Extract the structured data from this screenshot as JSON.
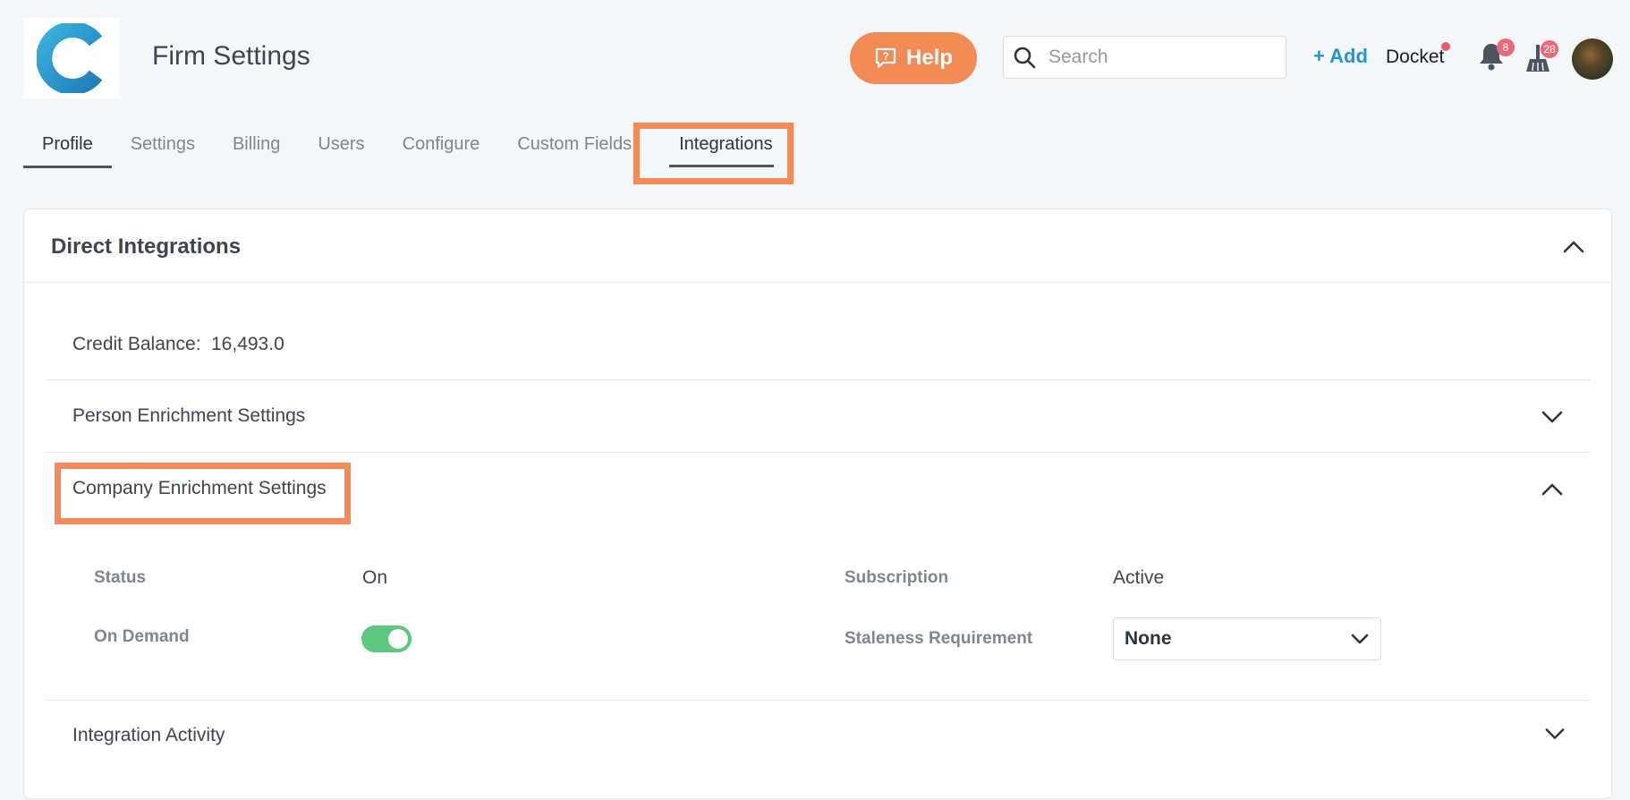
{
  "header": {
    "title": "Firm Settings",
    "help_label": "Help",
    "search_placeholder": "Search",
    "add_label": "+ Add",
    "docket_label": "Docket",
    "notifications_count": "8",
    "tasks_count": "28"
  },
  "tabs": [
    {
      "label": "Profile"
    },
    {
      "label": "Settings"
    },
    {
      "label": "Billing"
    },
    {
      "label": "Users"
    },
    {
      "label": "Configure"
    },
    {
      "label": "Custom Fields"
    },
    {
      "label": "Integrations"
    }
  ],
  "card": {
    "title": "Direct Integrations",
    "credit_balance_label": "Credit Balance:",
    "credit_balance_value": "16,493.0",
    "sections": {
      "person": "Person Enrichment Settings",
      "company": "Company Enrichment Settings",
      "activity": "Integration Activity"
    },
    "company_fields": {
      "status_label": "Status",
      "status_value": "On",
      "on_demand_label": "On Demand",
      "subscription_label": "Subscription",
      "subscription_value": "Active",
      "staleness_label": "Staleness Requirement",
      "staleness_value": "None"
    }
  },
  "colors": {
    "accent_orange": "#f48a55",
    "link_blue": "#1f96d6",
    "toggle_on": "#5cc87f",
    "badge_red": "#ec6a78"
  }
}
